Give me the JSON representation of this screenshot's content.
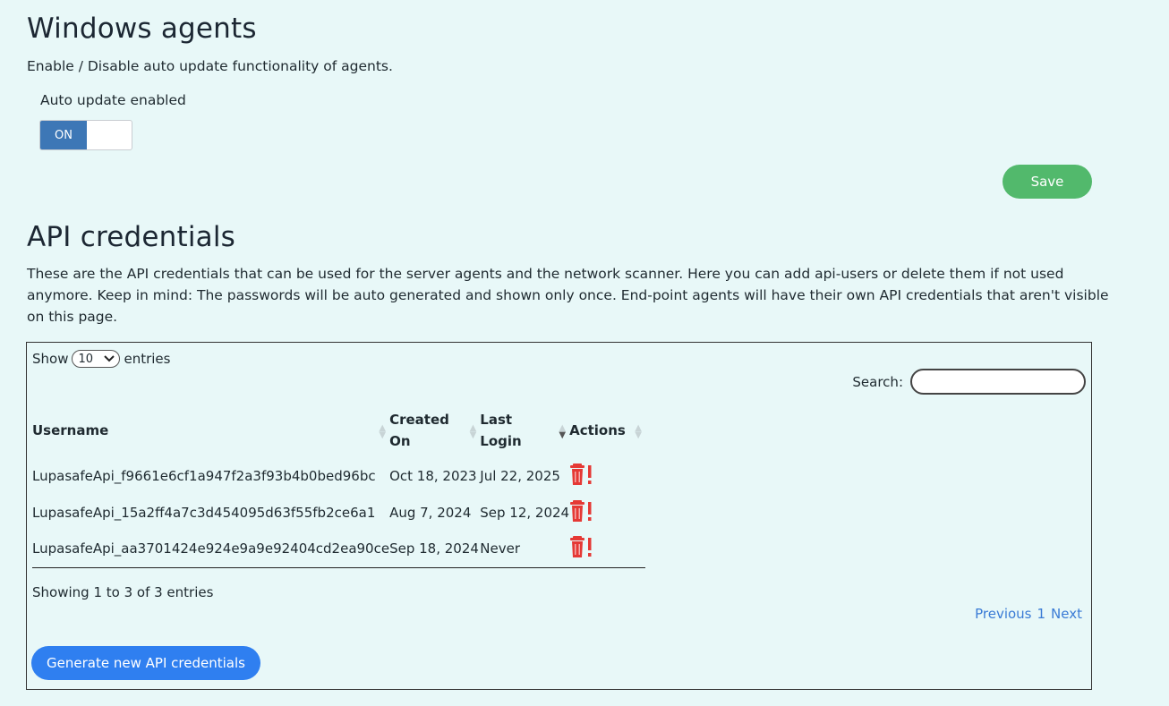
{
  "windows_agents": {
    "title": "Windows agents",
    "description": "Enable / Disable auto update functionality of agents.",
    "auto_update_label": "Auto update enabled",
    "toggle_on_label": "ON",
    "save_label": "Save"
  },
  "api": {
    "title": "API credentials",
    "description_line1": "These are the API credentials that can be used for the server agents and the network scanner. Here you can add api-users or delete them if not used",
    "description_line2": "anymore. Keep in mind: The passwords will be auto generated and shown only once. End-point agents will have their own API credentials that aren't visible",
    "description_line3": "on this page.",
    "show_label": "Show",
    "entries_select_value": "10",
    "entries_label": "entries",
    "search_label": "Search:",
    "search_value": "",
    "columns": {
      "username": "Username",
      "created_on_1": "Created",
      "created_on_2": "On",
      "last_login_1": "Last",
      "last_login_2": "Login",
      "actions": "Actions"
    },
    "rows": [
      {
        "username": "LupasafeApi_f9661e6cf1a947f2a3f93b4b0bed96bc",
        "created_on": "Oct 18, 2023",
        "last_login": "Jul 22, 2025"
      },
      {
        "username": "LupasafeApi_15a2ff4a7c3d454095d63f55fb2ce6a1",
        "created_on": "Aug 7, 2024",
        "last_login": "Sep 12, 2024"
      },
      {
        "username": "LupasafeApi_aa3701424e924e9a9e92404cd2ea90ce",
        "created_on": "Sep 18, 2024",
        "last_login": "Never"
      }
    ],
    "info_text": "Showing 1 to 3 of 3 entries",
    "pager": {
      "previous": "Previous",
      "page": "1",
      "next": "Next"
    },
    "generate_label": "Generate new API credentials"
  },
  "colors": {
    "background": "#e8f8f8",
    "toggle_on": "#3d77b6",
    "save_button": "#52b96c",
    "primary_button": "#2f7ff0",
    "delete_icon": "#e53935",
    "link": "#3a7bd5"
  },
  "icons": {
    "delete": "trash-alert-icon",
    "sort": "sort-arrows-icon"
  }
}
